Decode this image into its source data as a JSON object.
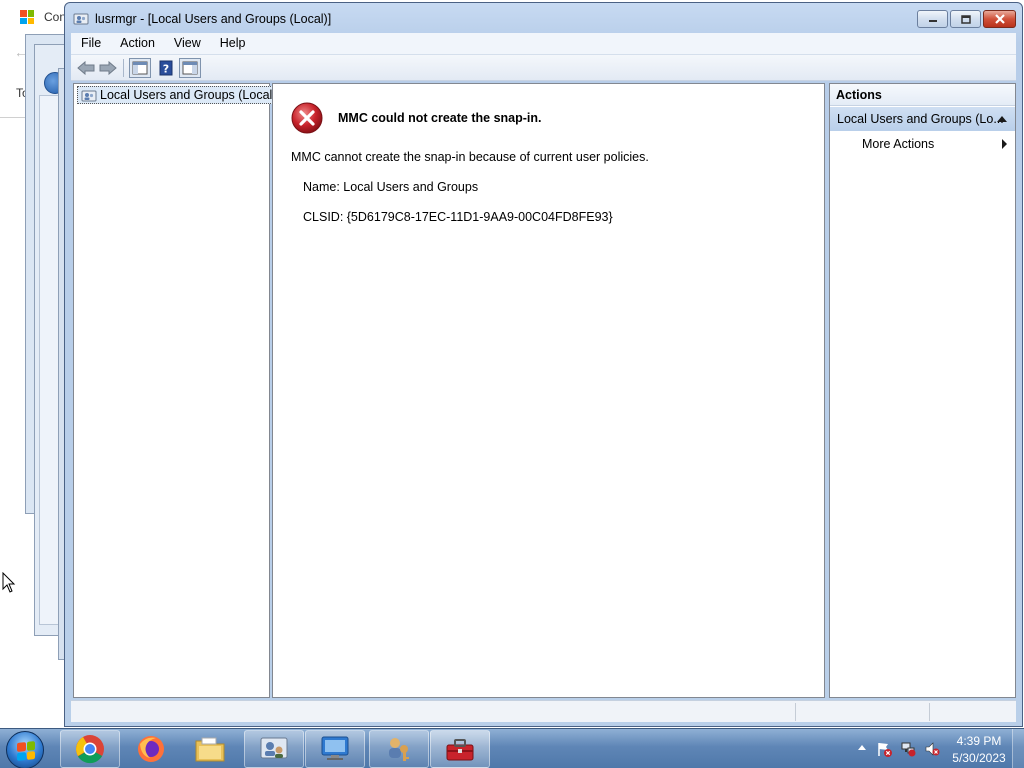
{
  "background": {
    "window_title": "Con",
    "partial_text": "To"
  },
  "window": {
    "title": "lusrmgr - [Local Users and Groups (Local)]",
    "minimize_icon": "minimize-icon",
    "maximize_icon": "restore-icon",
    "close_icon": "close-icon"
  },
  "menu": {
    "items": [
      {
        "label": "File"
      },
      {
        "label": "Action"
      },
      {
        "label": "View"
      },
      {
        "label": "Help"
      }
    ]
  },
  "toolbar": {
    "buttons": [
      "back-arrow-icon",
      "forward-arrow-icon",
      "show-hide-console-tree-icon",
      "help-icon",
      "show-hide-action-pane-icon"
    ]
  },
  "tree": {
    "root_label": "Local Users and Groups (Local)"
  },
  "error": {
    "title": "MMC could not create the snap-in.",
    "message": "MMC cannot create the snap-in because of current user policies.",
    "name_line": "Name: Local Users and Groups",
    "clsid_line": "CLSID: {5D6179C8-17EC-11D1-9AA9-00C04FD8FE93}"
  },
  "actions": {
    "header": "Actions",
    "section_label": "Local Users and Groups (Lo...",
    "more_actions": "More Actions"
  },
  "taskbar": {
    "apps": [
      "chrome-icon",
      "firefox-icon",
      "file-explorer-icon",
      "user-accounts-icon",
      "remote-desktop-icon",
      "users-keys-icon",
      "toolbox-icon"
    ],
    "clock_time": "4:39 PM",
    "clock_date": "5/30/2023"
  },
  "colors": {
    "accent_selection": "#dce9f7",
    "error_red": "#c8232b",
    "taskbar": "#5f86b6"
  }
}
